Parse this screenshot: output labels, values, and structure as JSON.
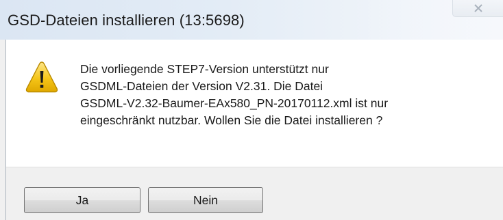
{
  "window": {
    "title": "GSD-Dateien installieren (13:5698)",
    "close_icon": "close-icon"
  },
  "message": {
    "icon": "warning-icon",
    "lines": [
      "Die vorliegende STEP7-Version unterstützt nur",
      "GSDML-Dateien der Version V2.31. Die Datei",
      "GSDML-V2.32-Baumer-EAx580_PN-20170112.xml ist nur",
      "eingeschränkt nutzbar. Wollen Sie die Datei installieren ?"
    ]
  },
  "buttons": {
    "yes_label": "Ja",
    "no_label": "Nein"
  },
  "colors": {
    "title_bar": "#dbe6f3",
    "message_background": "#ffffff",
    "footer_background": "#f0f0f0",
    "warning_yellow": "#f5c518"
  }
}
